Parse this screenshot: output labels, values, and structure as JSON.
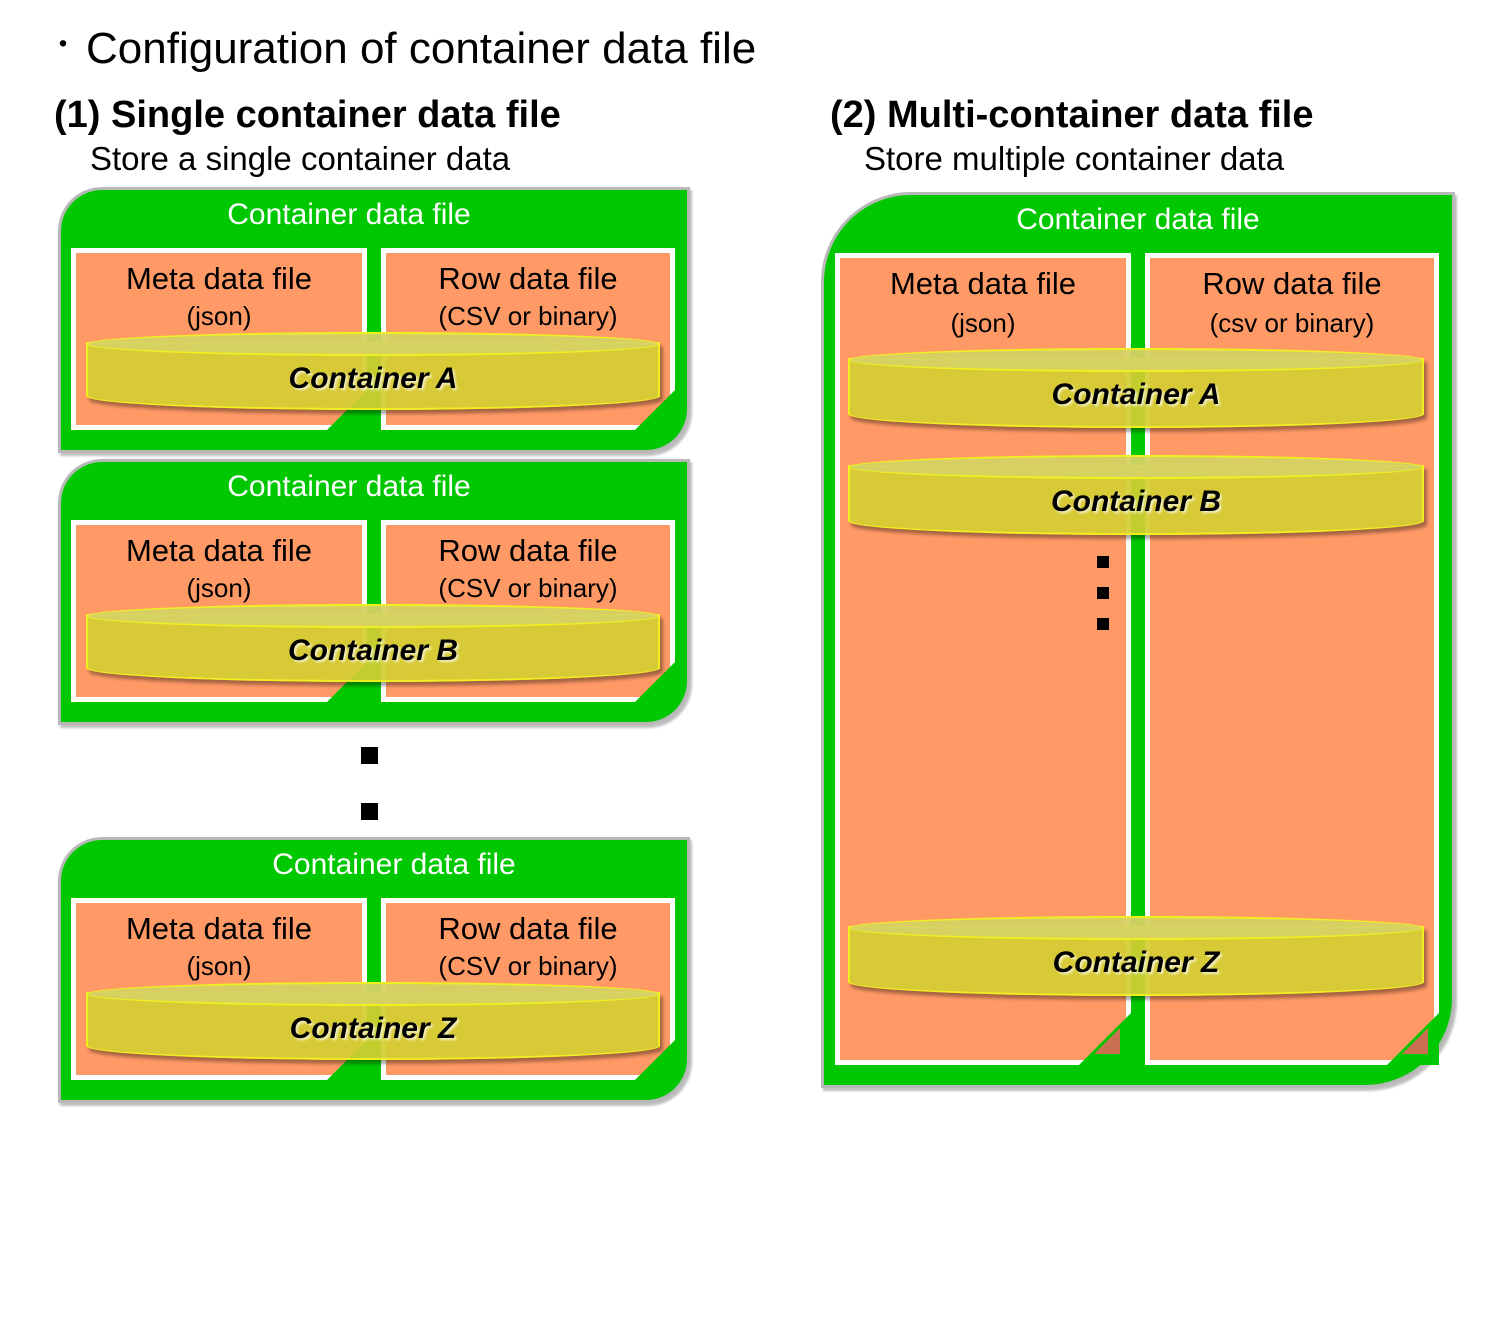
{
  "title": {
    "bullet": "・",
    "text": "Configuration of container data file"
  },
  "section1": {
    "heading": "(1) Single container data file",
    "subheading": "Store a single container data",
    "files": [
      {
        "label": "Container data file",
        "meta_title": "Meta data file",
        "meta_sub": "(json)",
        "row_title": "Row data file",
        "row_sub": "(CSV or binary)",
        "container": "Container A"
      },
      {
        "label": "Container data file",
        "meta_title": "Meta data file",
        "meta_sub": "(json)",
        "row_title": "Row data file",
        "row_sub": "(CSV or binary)",
        "container": "Container B"
      },
      {
        "label": "Container data file",
        "meta_title": "Meta data file",
        "meta_sub": "(json)",
        "row_title": "Row data file",
        "row_sub": "(CSV or binary)",
        "container": "Container Z"
      }
    ]
  },
  "section2": {
    "heading": "(2) Multi-container data file",
    "subheading": "Store multiple container data",
    "file": {
      "label": "Container data file",
      "meta_title": "Meta data file",
      "meta_sub": "(json)",
      "row_title": "Row data file",
      "row_sub": "(csv or binary)",
      "containers": [
        "Container A",
        "Container B",
        "Container Z"
      ]
    }
  },
  "colors": {
    "file_green": "#00c800",
    "page_orange": "#ff9966",
    "cylinder_yellow": "#d4ce32"
  }
}
